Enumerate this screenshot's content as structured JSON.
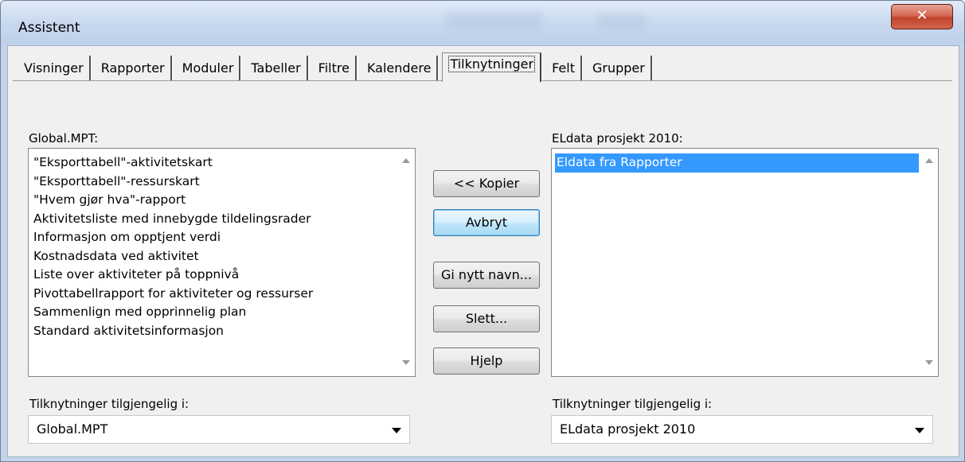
{
  "window": {
    "title": "Assistent",
    "close_glyph": "✕"
  },
  "tabs": [
    {
      "label": "Visninger"
    },
    {
      "label": "Rapporter"
    },
    {
      "label": "Moduler"
    },
    {
      "label": "Tabeller"
    },
    {
      "label": "Filtre"
    },
    {
      "label": "Kalendere"
    },
    {
      "label": "Tilknytninger",
      "active": true
    },
    {
      "label": "Felt"
    },
    {
      "label": "Grupper"
    }
  ],
  "left": {
    "label": "Global.MPT:",
    "items": [
      "\"Eksporttabell\"-aktivitetskart",
      "\"Eksporttabell\"-ressurskart",
      "\"Hvem gjør hva\"-rapport",
      "Aktivitetsliste med innebygde tildelingsrader",
      "Informasjon om opptjent verdi",
      "Kostnadsdata ved aktivitet",
      "Liste over aktiviteter på toppnivå",
      "Pivottabellrapport for aktiviteter og ressurser",
      "Sammenlign med opprinnelig plan",
      "Standard aktivitetsinformasjon"
    ],
    "available_label": "Tilknytninger tilgjengelig i:",
    "available_value": "Global.MPT"
  },
  "right": {
    "label": "ELdata prosjekt 2010:",
    "items": [
      "Eldata fra Rapporter"
    ],
    "available_label": "Tilknytninger tilgjengelig i:",
    "available_value": "ELdata prosjekt 2010"
  },
  "buttons": {
    "copy": "<< Kopier",
    "cancel": "Avbryt",
    "rename": "Gi nytt navn...",
    "delete": "Slett...",
    "help": "Hjelp"
  }
}
